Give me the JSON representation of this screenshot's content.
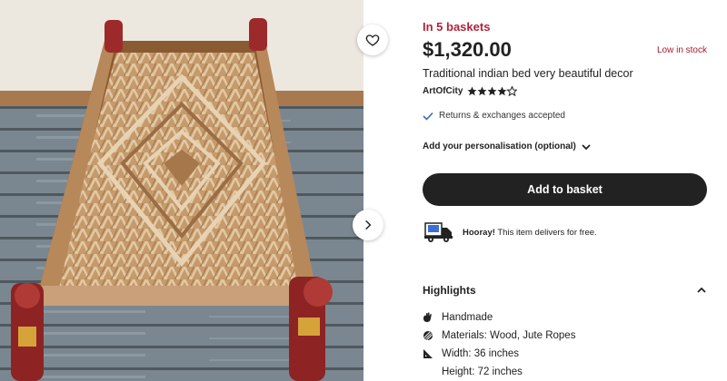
{
  "listing": {
    "baskets": "In 5 baskets",
    "price": "$1,320.00",
    "stock": "Low in stock",
    "title": "Traditional indian bed very beautiful decor",
    "seller": "ArtOfCity",
    "rating": 4,
    "rating_max": 5,
    "returns": "Returns & exchanges accepted",
    "personalisation": "Add your personalisation (optional)",
    "add_to_basket": "Add to basket",
    "delivery_bold": "Hooray!",
    "delivery_rest": " This item delivers for free."
  },
  "highlights": {
    "heading": "Highlights",
    "items": [
      {
        "icon": "hand-icon",
        "text": "Handmade"
      },
      {
        "icon": "materials-icon",
        "text": "Materials: Wood, Jute Ropes"
      },
      {
        "icon": "ruler-icon",
        "text": "Width: 36 inches"
      },
      {
        "icon": "",
        "text": "Height: 72 inches"
      }
    ]
  },
  "colors": {
    "accent_red": "#b2223d",
    "button_dark": "#222222"
  }
}
